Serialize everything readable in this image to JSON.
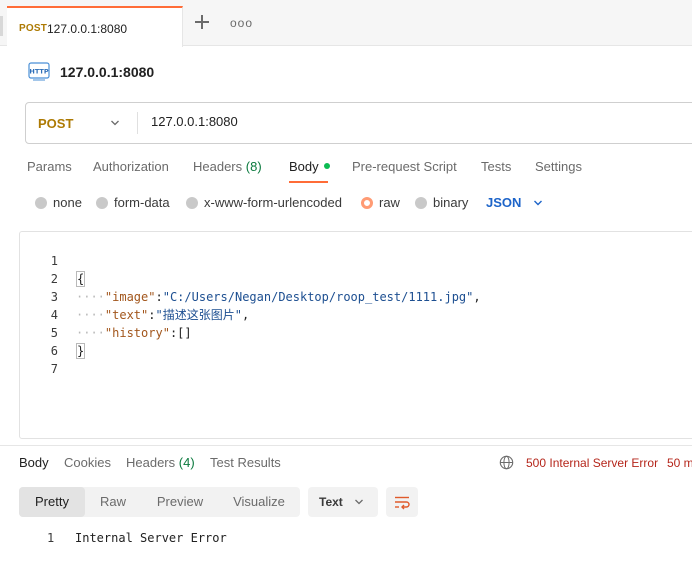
{
  "tab": {
    "method": "POST",
    "url": "127.0.0.1:8080"
  },
  "request": {
    "icon": "http-icon",
    "title": "127.0.0.1:8080",
    "method": "POST",
    "url": "127.0.0.1:8080"
  },
  "request_tabs": [
    {
      "label": "Params"
    },
    {
      "label": "Authorization"
    },
    {
      "label": "Headers",
      "count": "(8)"
    },
    {
      "label": "Body"
    },
    {
      "label": "Pre-request Script"
    },
    {
      "label": "Tests"
    },
    {
      "label": "Settings"
    }
  ],
  "body_types": [
    {
      "label": "none"
    },
    {
      "label": "form-data"
    },
    {
      "label": "x-www-form-urlencoded"
    },
    {
      "label": "raw",
      "selected": true
    },
    {
      "label": "binary"
    }
  ],
  "body_format": "JSON",
  "editor": {
    "line_numbers": [
      "1",
      "2",
      "3",
      "4",
      "5",
      "6",
      "7"
    ],
    "lines": [
      {
        "brace": "{"
      },
      {
        "indent": "····",
        "key": "\"image\"",
        "colon": ":",
        "value": "\"C:/Users/Negan/Desktop/roop_test/1111.jpg\"",
        "trail": ","
      },
      {
        "indent": "····",
        "key": "\"text\"",
        "colon": ":",
        "value": "\"描述这张图片\"",
        "trail": ","
      },
      {
        "indent": "····",
        "key": "\"history\"",
        "colon": ":",
        "value": "[]",
        "trail": ""
      },
      {
        "brace": "}"
      }
    ]
  },
  "response_tabs": [
    {
      "label": "Body"
    },
    {
      "label": "Cookies"
    },
    {
      "label": "Headers",
      "count": "(4)"
    },
    {
      "label": "Test Results"
    }
  ],
  "response_status": "500 Internal Server Error",
  "response_time": "50 m",
  "view_modes": [
    "Pretty",
    "Raw",
    "Preview",
    "Visualize"
  ],
  "response_format": "Text",
  "response_body": {
    "line_number": "1",
    "text": "Internal Server Error"
  },
  "colors": {
    "accent": "#ff6c37",
    "post_method": "#ad7a03",
    "error": "#b5261b",
    "json_blue": "#1d64c9",
    "count_green": "#0b7a3e"
  }
}
